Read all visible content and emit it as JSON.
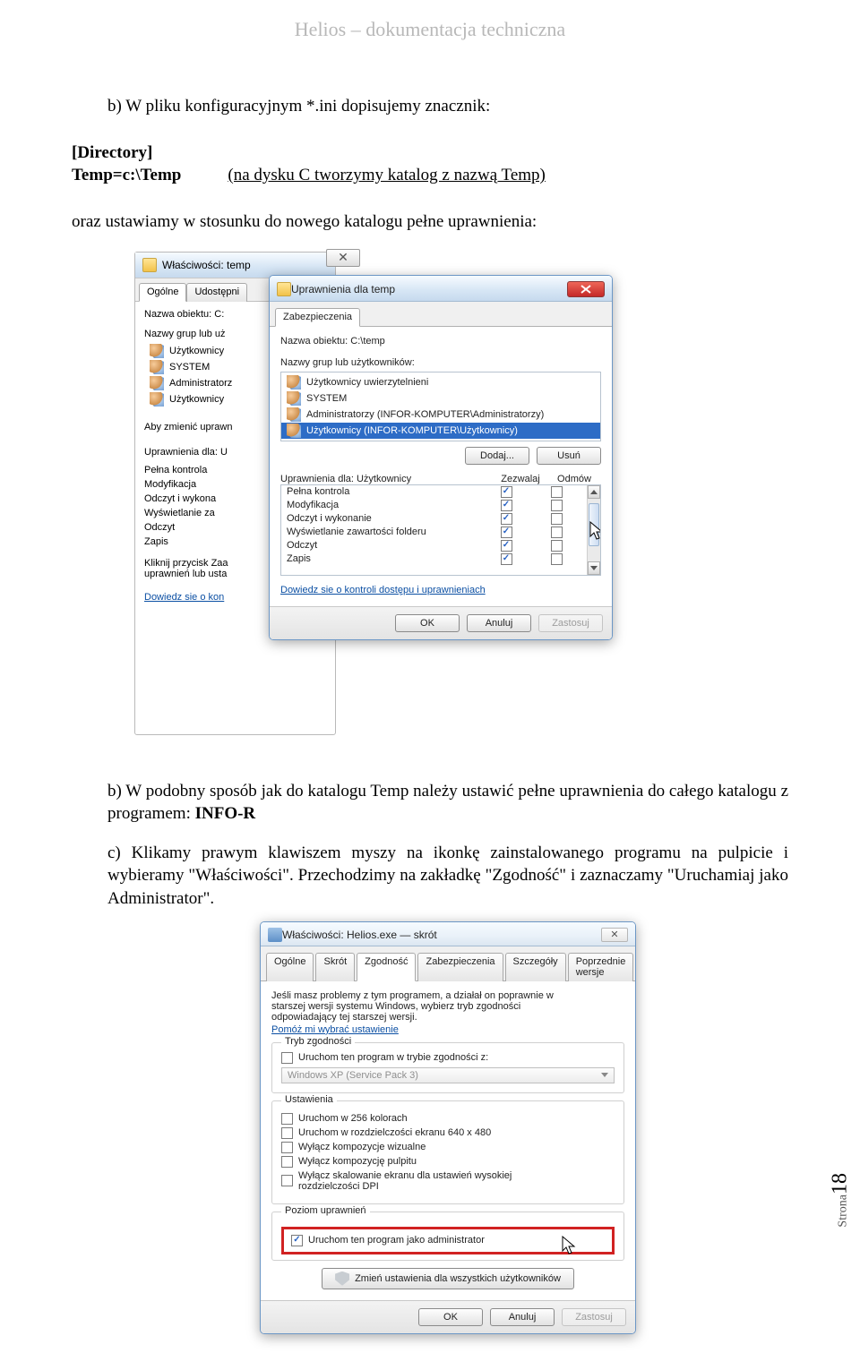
{
  "doc_header": "Helios – dokumentacja techniczna",
  "body": {
    "line_b1": "b)  W pliku konfiguracyjnym *.ini dopisujemy znacznik:",
    "dir_block_1": "[Directory]",
    "dir_block_2a": "Temp=c:\\Temp",
    "dir_block_2b": "(na dysku C tworzymy katalog z nazwą Temp)",
    "line_after_dir": "oraz ustawiamy w stosunku do nowego katalogu pełne uprawnienia:",
    "line_b2": "b)  W podobny sposób jak do katalogu Temp należy ustawić pełne uprawnienia do całego katalogu z programem: ",
    "info_r": "INFO-R",
    "line_c": "c)   Klikamy prawym klawiszem myszy na ikonkę zainstalowanego programu na pulpicie i wybieramy \"Właściwości\". Przechodzimy na zakładkę \"Zgodność\" i zaznaczamy \"Uruchamiaj jako Administrator\"."
  },
  "page_number": {
    "label": "Strona",
    "num": "18"
  },
  "dlg_back": {
    "title": "Właściwości: temp",
    "tabs": [
      "Ogólne",
      "Udostępni"
    ],
    "obj_label": "Nazwa obiektu:  C:",
    "groups_label": "Nazwy grup lub uż",
    "groups": [
      "Użytkownicy",
      "SYSTEM",
      "Administratorz",
      "Użytkownicy"
    ],
    "change_hint": "Aby zmienić uprawn",
    "perm_for": "Uprawnienia dla: U",
    "perm_list": [
      "Pełna kontrola",
      "Modyfikacja",
      "Odczyt i wykona",
      "Wyświetlanie za",
      "Odczyt",
      "Zapis"
    ],
    "click_hint1": "Kliknij przycisk Zaa",
    "click_hint2": "uprawnień lub usta",
    "learn_link": "Dowiedz sie o kon"
  },
  "dlg_front": {
    "title": "Uprawnienia dla temp",
    "tab": "Zabezpieczenia",
    "obj_label": "Nazwa obiektu:  C:\\temp",
    "groups_label": "Nazwy grup lub użytkowników:",
    "groups": [
      "Użytkownicy uwierzytelnieni",
      "SYSTEM",
      "Administratorzy (INFOR-KOMPUTER\\Administratorzy)",
      "Użytkownicy (INFOR-KOMPUTER\\Użytkownicy)"
    ],
    "btn_add": "Dodaj...",
    "btn_remove": "Usuń",
    "perm_for": "Uprawnienia dla: Użytkownicy",
    "col_allow": "Zezwalaj",
    "col_deny": "Odmów",
    "perms": [
      {
        "name": "Pełna kontrola",
        "allow": true,
        "deny": false
      },
      {
        "name": "Modyfikacja",
        "allow": true,
        "deny": false
      },
      {
        "name": "Odczyt i wykonanie",
        "allow": true,
        "deny": false
      },
      {
        "name": "Wyświetlanie zawartości folderu",
        "allow": true,
        "deny": false
      },
      {
        "name": "Odczyt",
        "allow": true,
        "deny": false
      },
      {
        "name": "Zapis",
        "allow": true,
        "deny": false
      }
    ],
    "learn_link": "Dowiedz sie o kontroli dostępu i uprawnieniach",
    "btn_ok": "OK",
    "btn_cancel": "Anuluj",
    "btn_apply": "Zastosuj"
  },
  "dlg_compat": {
    "title": "Właściwości: Helios.exe — skrót",
    "tabs": [
      "Ogólne",
      "Skrót",
      "Zgodność",
      "Zabezpieczenia",
      "Szczegóły",
      "Poprzednie wersje"
    ],
    "hint1": "Jeśli masz problemy z tym programem, a działał on poprawnie w",
    "hint2": "starszej wersji systemu Windows, wybierz tryb zgodności",
    "hint3": "odpowiadający tej starszej wersji.",
    "help_link": "Pomóż mi wybrać ustawienie",
    "grp_compat": "Tryb zgodności",
    "chk_compat": "Uruchom ten program w trybie zgodności z:",
    "combo_val": "Windows XP (Service Pack 3)",
    "grp_settings": "Ustawienia",
    "chk_256": "Uruchom w 256 kolorach",
    "chk_640": "Uruchom w rozdzielczości ekranu 640 x 480",
    "chk_visual": "Wyłącz kompozycje wizualne",
    "chk_desktopcomp": "Wyłącz kompozycję pulpitu",
    "chk_dpi1": "Wyłącz skalowanie ekranu dla ustawień wysokiej",
    "chk_dpi2": "rozdzielczości DPI",
    "grp_priv": "Poziom uprawnień",
    "chk_admin": "Uruchom ten program jako administrator",
    "btn_allusers": "Zmień ustawienia dla wszystkich użytkowników",
    "btn_ok": "OK",
    "btn_cancel": "Anuluj",
    "btn_apply": "Zastosuj"
  }
}
